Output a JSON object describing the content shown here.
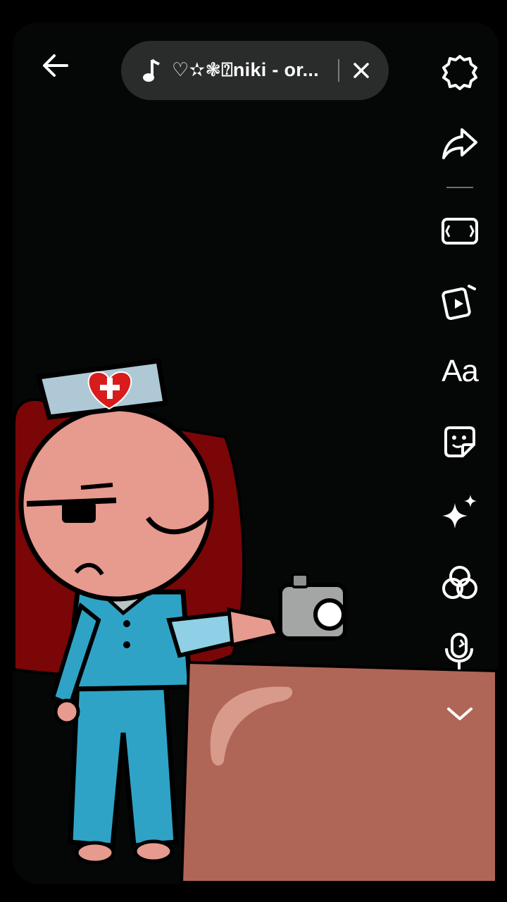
{
  "music": {
    "title": "♡✫❃⍰niki - or..."
  },
  "toolbar": {
    "text_tool_label": "Aa",
    "tools": [
      "settings-icon",
      "share-icon",
      "aspect-ratio-icon",
      "clips-icon",
      "text-icon",
      "sticker-icon",
      "effects-icon",
      "filters-icon",
      "voice-effect-icon",
      "more-icon"
    ]
  },
  "colors": {
    "canvas_background": "#040705",
    "pill_background": "#2a2c2b",
    "skin": "#e79a8e",
    "uniform": "#2fa3c6",
    "hair": "#7a0607",
    "box": "#b06656"
  }
}
